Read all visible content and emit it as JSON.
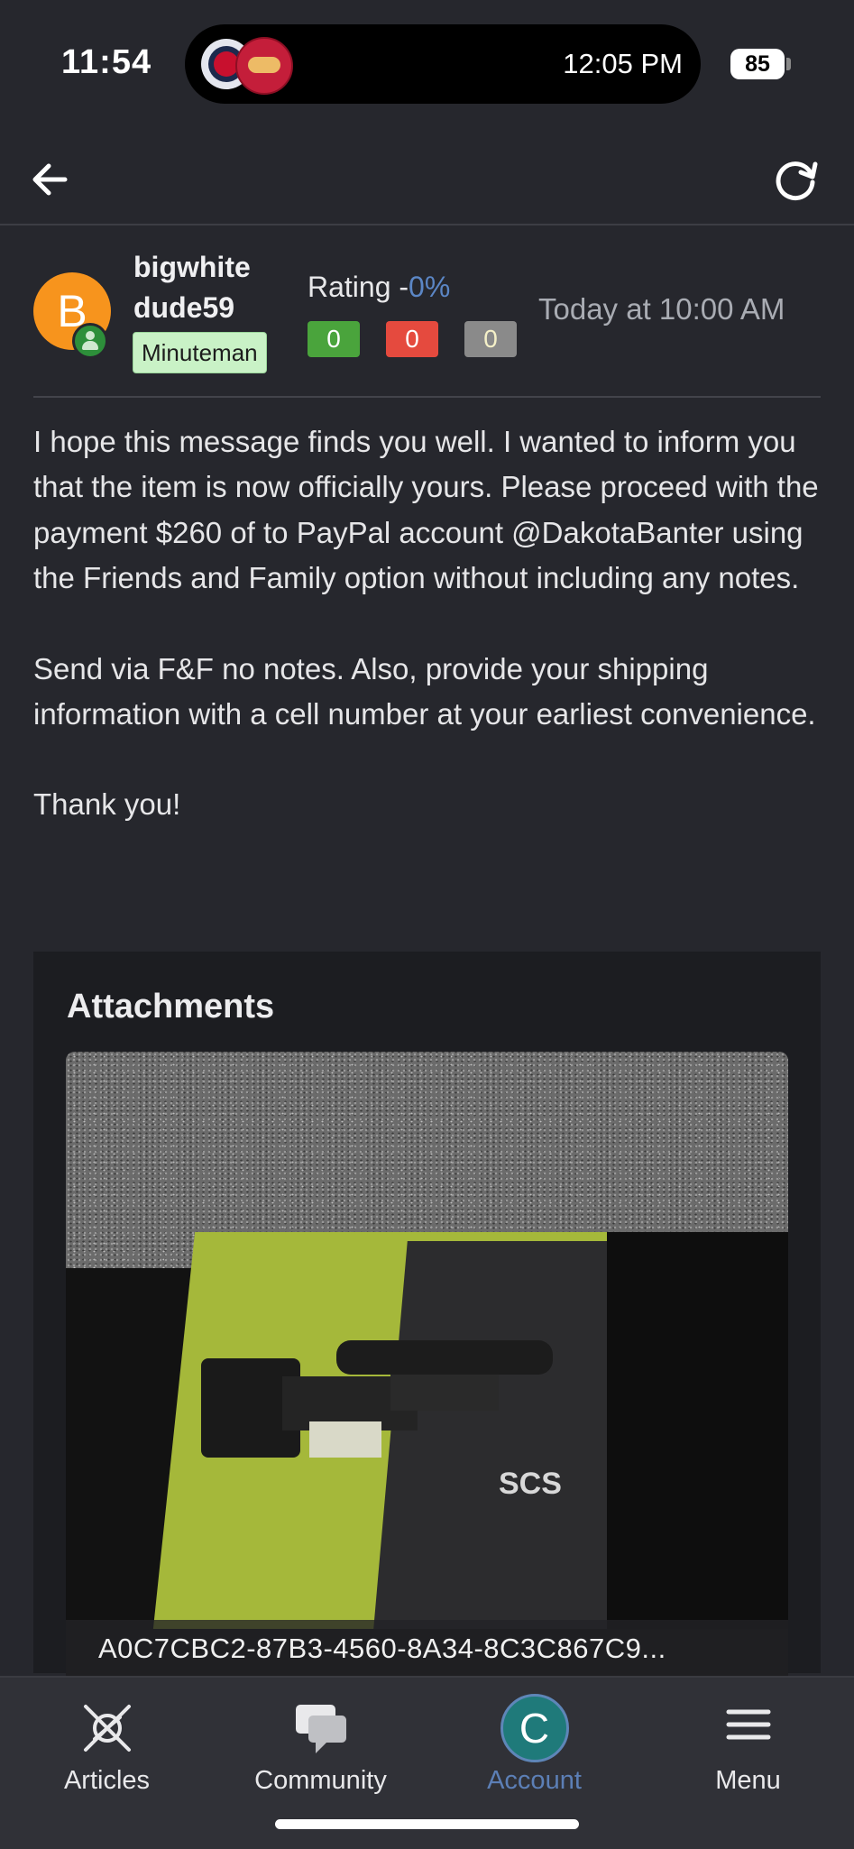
{
  "status_bar": {
    "time": "11:54",
    "live_activity_time": "12:05 PM",
    "battery": "85"
  },
  "post": {
    "avatar_letter": "B",
    "username_line1": "bigwhite",
    "username_line2": "dude59",
    "user_title": "Minuteman",
    "rating_label": "Rating -",
    "rating_pct": "0%",
    "scores": {
      "positive": "0",
      "negative": "0",
      "neutral": "0"
    },
    "timestamp": "Today at 10:00 AM",
    "paragraphs": [
      "I hope this message finds you well. I wanted to inform you that the item is now officially yours. Please proceed with the payment $260 of to PayPal account @DakotaBanter using the Friends and Family option without including any notes.",
      "Send via F&F no notes. Also, provide your shipping information with a cell number at your earliest convenience.",
      "Thank you!"
    ]
  },
  "attachments": {
    "title": "Attachments",
    "image_text": "SCS",
    "file_name": "A0C7CBC2-87B3-4560-8A34-8C3C867C9..."
  },
  "tabbar": {
    "tabs": [
      {
        "label": "Articles",
        "icon": "articles-icon"
      },
      {
        "label": "Community",
        "icon": "chat-bubbles-icon"
      },
      {
        "label": "Account",
        "icon": "account-avatar",
        "avatar_letter": "C",
        "active": true
      },
      {
        "label": "Menu",
        "icon": "hamburger-icon"
      }
    ]
  },
  "colors": {
    "background": "#26272d",
    "active_tab": "#5c7fb6",
    "avatar": "#f7941d",
    "title_badge": "#c9f2c6",
    "positive": "#4aa43c",
    "negative": "#e54a3e",
    "neutral": "#8a8a8a"
  }
}
